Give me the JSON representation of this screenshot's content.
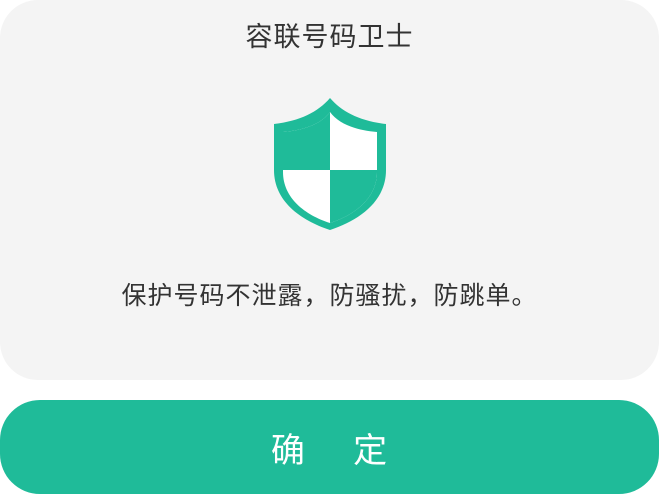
{
  "dialog": {
    "title": "容联号码卫士",
    "icon": "shield-icon",
    "message": "保护号码不泄露，防骚扰，防跳单。",
    "confirm_label": "确    定"
  },
  "colors": {
    "accent": "#1fbb99",
    "card_bg": "#f4f4f4",
    "text": "#333333",
    "button_text": "#ffffff"
  }
}
